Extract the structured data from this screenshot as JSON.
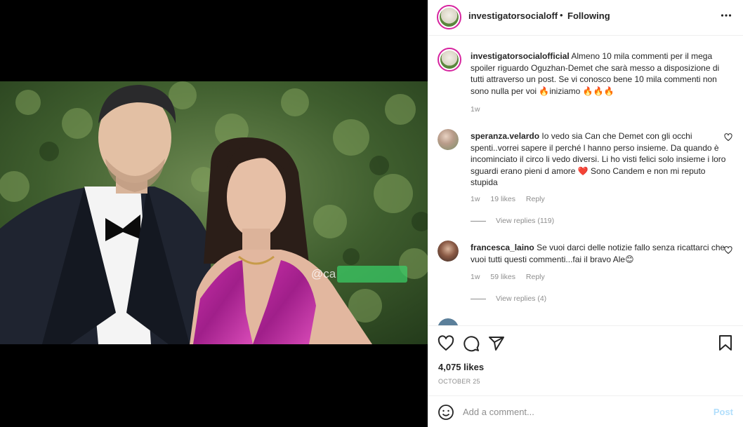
{
  "header": {
    "username": "investigatorsocialofficial",
    "username_visible": "investigatorsocialoffici",
    "separator": "•",
    "follow_status": "Following",
    "more_icon": "more-horizontal-icon"
  },
  "image": {
    "watermark": "@ca"
  },
  "caption": {
    "username": "investigatorsocialofficial",
    "text": "Almeno 10 mila commenti per il mega spoiler riguardo Oguzhan-Demet che sarà messo a disposizione di tutti attraverso un post. Se vi conosco bene 10 mila commenti non sono nulla per voi 🔥iniziamo 🔥🔥🔥",
    "time": "1w"
  },
  "comments": [
    {
      "username": "speranza.velardo",
      "text": "Io vedo sia Can che Demet con gli occhi spenti..vorrei sapere il perché l hanno perso insieme. Da quando è incominciato il circo li vedo diversi. Li ho visti felici solo insieme i loro sguardi erano pieni d amore ❤️ Sono Candem e non mi reputo stupida",
      "time": "1w",
      "likes": "19 likes",
      "reply": "Reply",
      "view_replies": "View replies (119)"
    },
    {
      "username": "francesca_laino",
      "text": "Se vuoi darci delle notizie fallo senza ricattarci che vuoi tutti questi commenti...fai il bravo Ale😊",
      "time": "1w",
      "likes": "59 likes",
      "reply": "Reply",
      "view_replies": "View replies (4)"
    }
  ],
  "actions": {
    "likes": "4,075 likes",
    "date": "OCTOBER 25"
  },
  "add_comment": {
    "placeholder": "Add a comment...",
    "post_label": "Post"
  },
  "colors": {
    "accent": "#0095f6",
    "post_disabled": "#b2dffc",
    "muted": "#8e8e8e",
    "text": "#262626"
  }
}
